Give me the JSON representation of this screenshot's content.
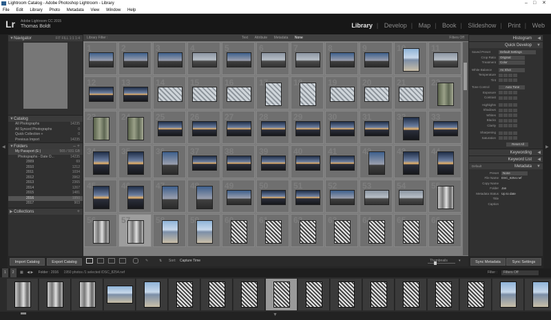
{
  "window": {
    "title": "Lightroom Catalog - Adobe Photoshop Lightroom - Library"
  },
  "menu": [
    "File",
    "Edit",
    "Library",
    "Photo",
    "Metadata",
    "View",
    "Window",
    "Help"
  ],
  "identity": {
    "logo": "Lr",
    "product": "Adobe Lightroom CC 2015",
    "user": "Thomas Boldt"
  },
  "modules": [
    "Library",
    "Develop",
    "Map",
    "Book",
    "Slideshow",
    "Print",
    "Web"
  ],
  "active_module": "Library",
  "left_panel": {
    "navigator": {
      "title": "Navigator",
      "zoom": [
        "FIT",
        "FILL",
        "1:1",
        "1:4"
      ]
    },
    "catalog": {
      "title": "Catalog",
      "items": [
        {
          "label": "All Photographs",
          "count": "14235"
        },
        {
          "label": "All Synced Photographs",
          "count": "0"
        },
        {
          "label": "Quick Collection +",
          "count": "0"
        },
        {
          "label": "Previous Import",
          "count": "14235"
        }
      ]
    },
    "folders": {
      "title": "Folders",
      "drive": "My Passport (E:)",
      "drive_space": "565 / 931 GB",
      "items": [
        {
          "label": "Photographs - Date O...",
          "count": "14235"
        },
        {
          "label": "2009",
          "count": "69"
        },
        {
          "label": "2010",
          "count": "1212"
        },
        {
          "label": "2011",
          "count": "1034"
        },
        {
          "label": "2012",
          "count": "3962"
        },
        {
          "label": "2013",
          "count": "2365"
        },
        {
          "label": "2014",
          "count": "1267"
        },
        {
          "label": "2015",
          "count": "1481"
        },
        {
          "label": "2016",
          "count": "1950"
        },
        {
          "label": "2017",
          "count": "903"
        }
      ]
    },
    "collections": {
      "title": "Collections"
    },
    "import_btn": "Import Catalog",
    "export_btn": "Export Catalog"
  },
  "filter_bar": {
    "label": "Library Filter :",
    "tabs": [
      "Text",
      "Attribute",
      "Metadata",
      "None"
    ],
    "active": "None",
    "filters_off": "Filters Off"
  },
  "grid": {
    "numbers": [
      "1",
      "2",
      "3",
      "4",
      "5",
      "6",
      "7",
      "8",
      "9",
      "10",
      "11",
      "12",
      "13",
      "14",
      "15",
      "16",
      "17",
      "18",
      "19",
      "20",
      "21",
      "22",
      "23",
      "24",
      "25",
      "26",
      "27",
      "28",
      "29",
      "30",
      "31",
      "32",
      "33",
      "34",
      "35",
      "36",
      "37",
      "38",
      "39",
      "40",
      "41",
      "42",
      "43",
      "44",
      "45",
      "46",
      "47",
      "48",
      "49",
      "50",
      "51",
      "52",
      "53",
      "54",
      "55",
      "56",
      "57",
      "58",
      "59",
      "60",
      "61",
      "62",
      "63",
      "64",
      "65",
      "66"
    ]
  },
  "toolbar": {
    "sort_label": "Sort:",
    "sort_value": "Capture Time",
    "thumbnails": "Thumbnails"
  },
  "right_panel": {
    "histogram": "Histogram",
    "quick_develop": "Quick Develop",
    "saved_preset": {
      "label": "Saved Preset",
      "value": "Default Settings"
    },
    "crop": {
      "label": "Crop Ratio",
      "value": "Original"
    },
    "treatment": {
      "label": "Treatment",
      "value": "Color"
    },
    "wb": {
      "label": "White Balance",
      "value": "As Shot"
    },
    "temperature": "Temperature",
    "tint": "Tint",
    "tone": {
      "label": "Tone Control",
      "value": "Auto Tone"
    },
    "sliders": [
      "Exposure",
      "Contrast",
      "Highlights",
      "Shadows",
      "Whites",
      "Blacks",
      "Clarity",
      "Sharpening",
      "Saturation"
    ],
    "reset": "Reset All",
    "keywording": "Keywording",
    "keyword_list": "Keyword List",
    "metadata": {
      "title": "Metadata",
      "mode": "Default",
      "preset_label": "Preset",
      "preset_value": "None",
      "fields": [
        {
          "label": "File Name",
          "value": "DSC_8254.nef"
        },
        {
          "label": "Copy Name",
          "value": ""
        },
        {
          "label": "Folder",
          "value": "Jan"
        },
        {
          "label": "Metadata Status",
          "value": "Up to date"
        },
        {
          "label": "Title",
          "value": ""
        },
        {
          "label": "Caption",
          "value": ""
        }
      ]
    },
    "sync_meta": "Sync Metadata",
    "sync_settings": "Sync Settings"
  },
  "filmstrip_bar": {
    "pages": [
      "1",
      "2"
    ],
    "source": "Folder : 2016",
    "info": "1950 photos /1 selected /DSC_8254.nef",
    "filter_label": "Filter :",
    "filter_value": "Filters Off"
  }
}
